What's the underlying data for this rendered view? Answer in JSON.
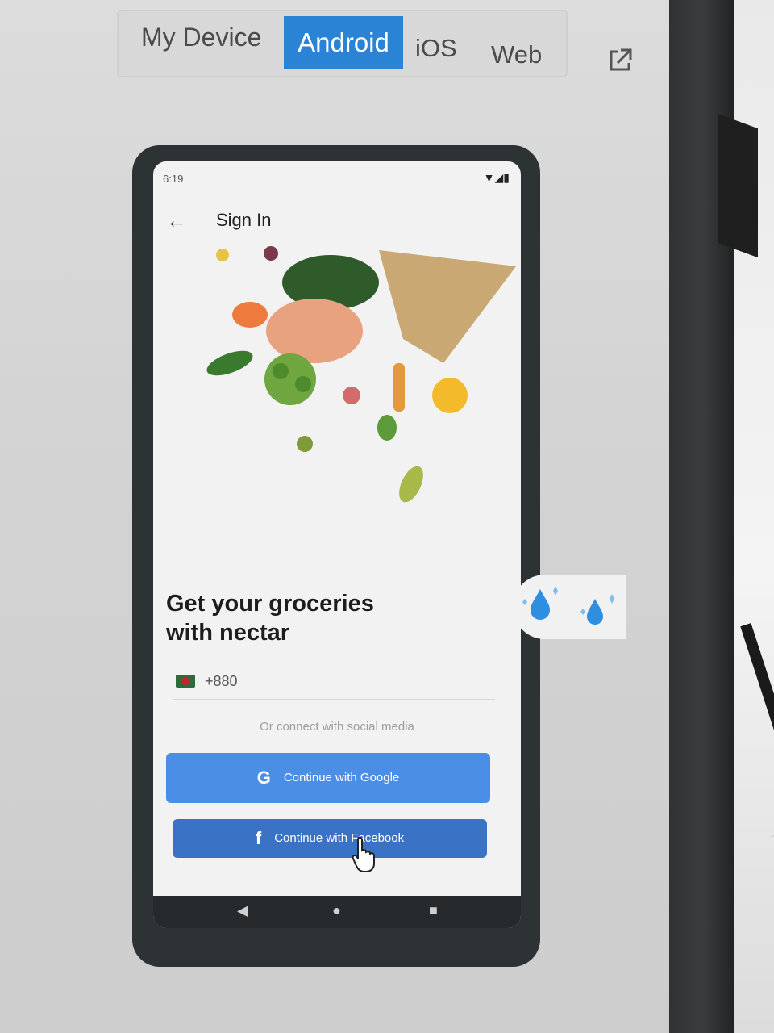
{
  "tabs": [
    {
      "label": "My Device"
    },
    {
      "label": "Android",
      "selected": true
    },
    {
      "label": "iOS"
    },
    {
      "label": "Web"
    }
  ],
  "colors": {
    "accent": "#2b83d6",
    "google_button": "#4b8ee6",
    "facebook_button": "#3a72c5"
  },
  "device": {
    "status": {
      "time": "6:19",
      "icons": "▼◢▮"
    },
    "appbar": {
      "back_icon": "←",
      "title": "Sign In"
    },
    "headline_line1": "Get your groceries",
    "headline_line2": "with nectar",
    "phone_input": {
      "country_code": "+880"
    },
    "divider_text": "Or connect with social media",
    "buttons": {
      "google": {
        "icon": "G",
        "label": "Continue with Google"
      },
      "facebook": {
        "icon": "f",
        "label": "Continue with Facebook"
      }
    },
    "navbar": {
      "back": "◀",
      "home": "●",
      "recent": "■"
    }
  }
}
